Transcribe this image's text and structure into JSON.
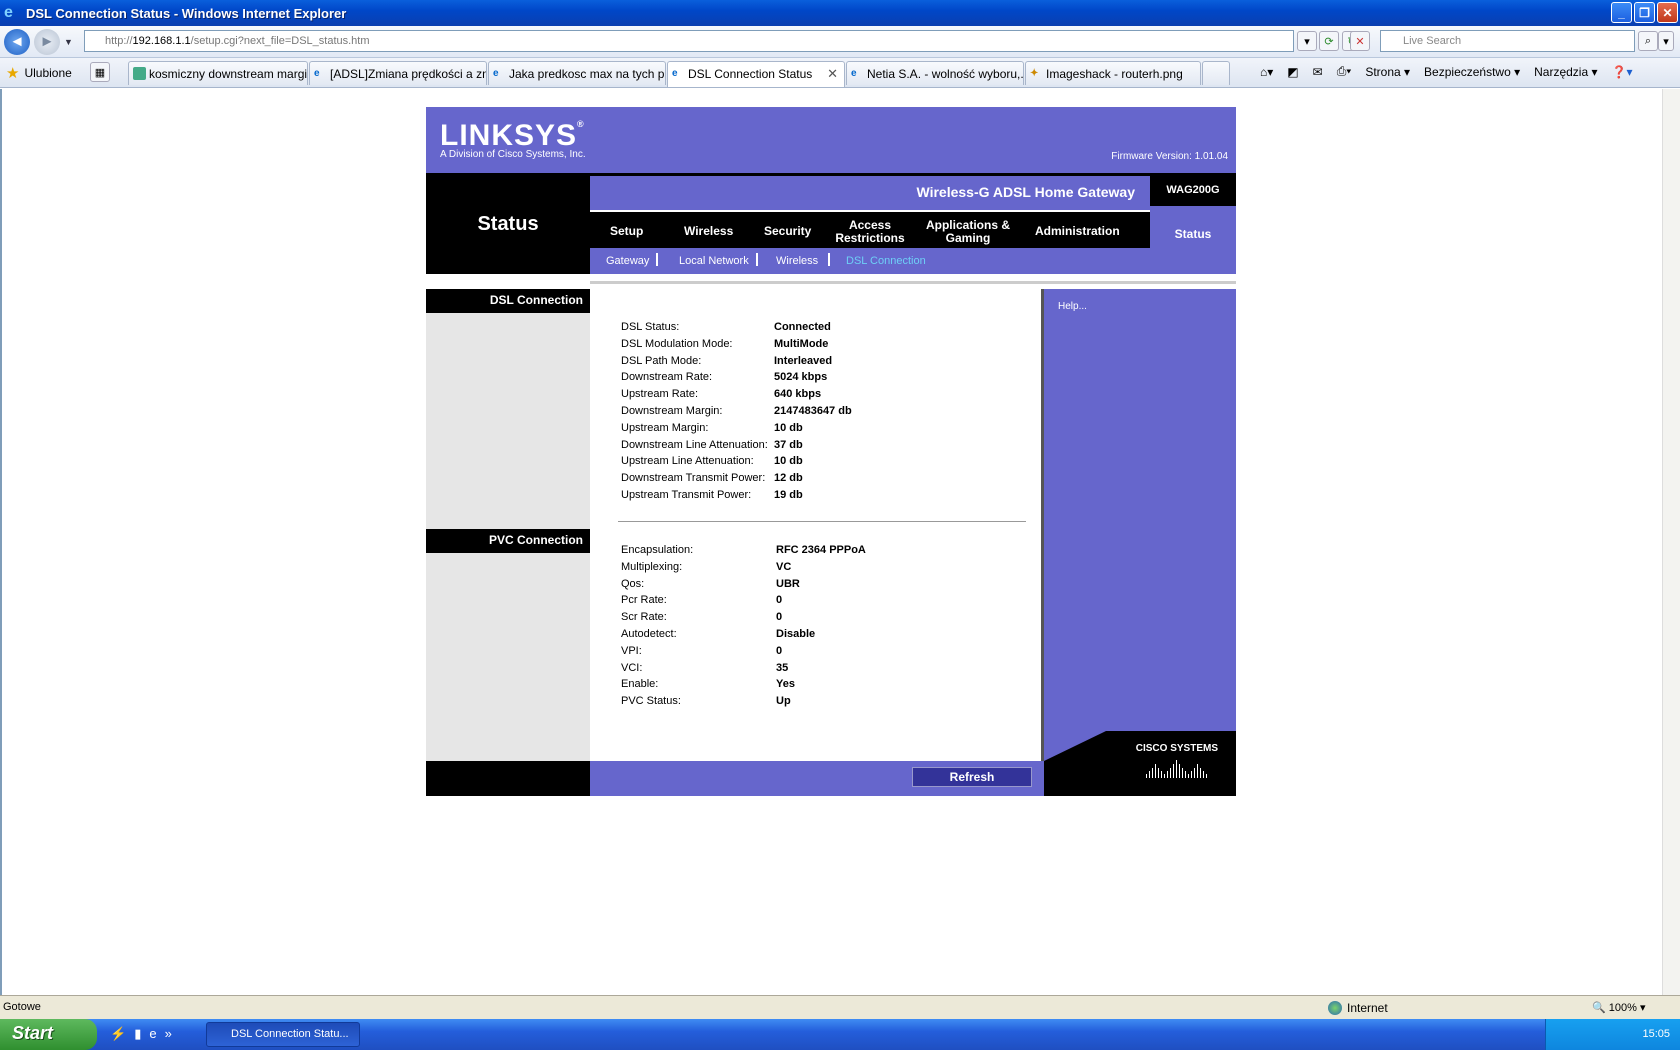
{
  "window": {
    "title": "DSL Connection Status - Windows Internet Explorer"
  },
  "address": {
    "url_prefix": "http://",
    "url_host": "192.168.1.1",
    "url_rest": "/setup.cgi?next_file=DSL_status.htm",
    "search_placeholder": "Live Search"
  },
  "favorites": {
    "label": "Ulubione"
  },
  "tabs": [
    {
      "label": "kosmiczny downstream margi..."
    },
    {
      "label": "[ADSL]Zmiana prędkości a zm..."
    },
    {
      "label": "Jaka predkosc max na tych p..."
    },
    {
      "label": "DSL Connection Status"
    },
    {
      "label": "Netia S.A. - wolność wyboru,..."
    },
    {
      "label": "Imageshack - routerh.png"
    }
  ],
  "toolbar": {
    "page": "Strona",
    "safety": "Bezpieczeństwo",
    "tools": "Narzędzia"
  },
  "router": {
    "logo": "LINKSYS",
    "logo_reg": "®",
    "division": "A Division of Cisco Systems, Inc.",
    "firmware": "Firmware Version: 1.01.04",
    "section_title": "Status",
    "product": "Wireless-G ADSL Home Gateway",
    "model": "WAG200G",
    "menu": {
      "setup": "Setup",
      "wireless": "Wireless",
      "security": "Security",
      "access_1": "Access",
      "access_2": "Restrictions",
      "apps_1": "Applications &",
      "apps_2": "Gaming",
      "admin": "Administration",
      "status": "Status"
    },
    "submenu": {
      "gateway": "Gateway",
      "local": "Local Network",
      "wireless": "Wireless",
      "dsl": "DSL Connection"
    },
    "dsl_header": "DSL Connection",
    "pvc_header": "PVC Connection",
    "help": "Help...",
    "refresh": "Refresh",
    "cisco": "CISCO SYSTEMS",
    "dsl": [
      {
        "label": "DSL Status:",
        "value": "Connected"
      },
      {
        "label": "DSL Modulation Mode:",
        "value": "MultiMode"
      },
      {
        "label": "DSL Path Mode:",
        "value": "Interleaved"
      },
      {
        "label": "Downstream Rate:",
        "value": "5024 kbps"
      },
      {
        "label": "Upstream Rate:",
        "value": "640 kbps"
      },
      {
        "label": "Downstream Margin:",
        "value": "2147483647 db"
      },
      {
        "label": "Upstream Margin:",
        "value": "10 db"
      },
      {
        "label": "Downstream Line Attenuation:",
        "value": "37 db"
      },
      {
        "label": "Upstream Line Attenuation:",
        "value": "10 db"
      },
      {
        "label": "Downstream Transmit Power:",
        "value": "12 db"
      },
      {
        "label": "Upstream Transmit Power:",
        "value": "19 db"
      }
    ],
    "pvc": [
      {
        "label": "Encapsulation:",
        "value": "RFC 2364 PPPoA"
      },
      {
        "label": "Multiplexing:",
        "value": "VC"
      },
      {
        "label": "Qos:",
        "value": "UBR"
      },
      {
        "label": "Pcr Rate:",
        "value": "0"
      },
      {
        "label": "Scr Rate:",
        "value": "0"
      },
      {
        "label": "Autodetect:",
        "value": "Disable"
      },
      {
        "label": "VPI:",
        "value": "0"
      },
      {
        "label": "VCI:",
        "value": "35"
      },
      {
        "label": "Enable:",
        "value": "Yes"
      },
      {
        "label": "PVC Status:",
        "value": "Up"
      }
    ]
  },
  "statusbar": {
    "ready": "Gotowe",
    "zone": "Internet",
    "zoom": "100%"
  },
  "taskbar": {
    "start": "Start",
    "task": "DSL Connection Statu...",
    "clock": "15:05"
  }
}
